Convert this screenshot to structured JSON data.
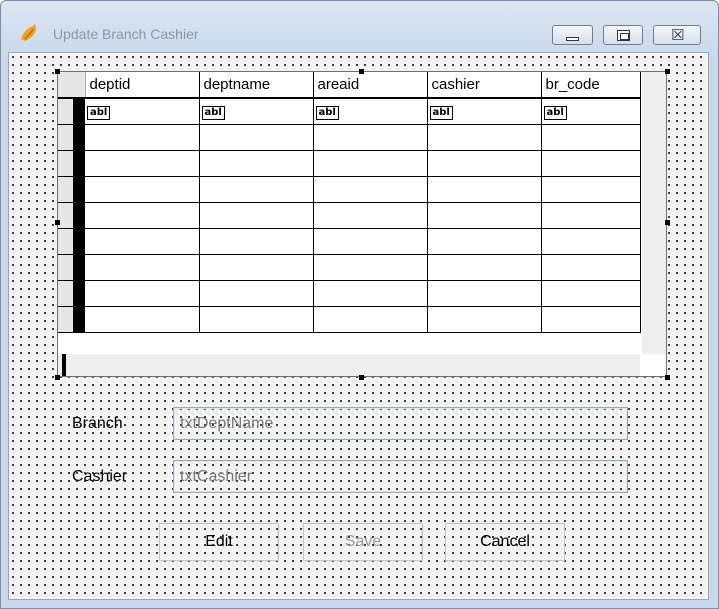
{
  "window": {
    "title": "Update Branch Cashier",
    "app_icon": "foxpro-fox-icon",
    "controls": {
      "minimize_icon": "minimize-icon",
      "maximize_icon": "maximize-icon",
      "close_icon": "close-icon",
      "close_glyph": "☒"
    }
  },
  "grid": {
    "columns": [
      "deptid",
      "deptname",
      "areaid",
      "cashier",
      "br_code"
    ],
    "cell_placeholder": "abl",
    "empty_rows": 9
  },
  "form": {
    "branch_label": "Branch",
    "branch_value": "txtDeptName",
    "cashier_label": "Cashier",
    "cashier_value": "txtCashier"
  },
  "buttons": {
    "edit": "Edit",
    "save": "Save",
    "cancel": "Cancel"
  }
}
